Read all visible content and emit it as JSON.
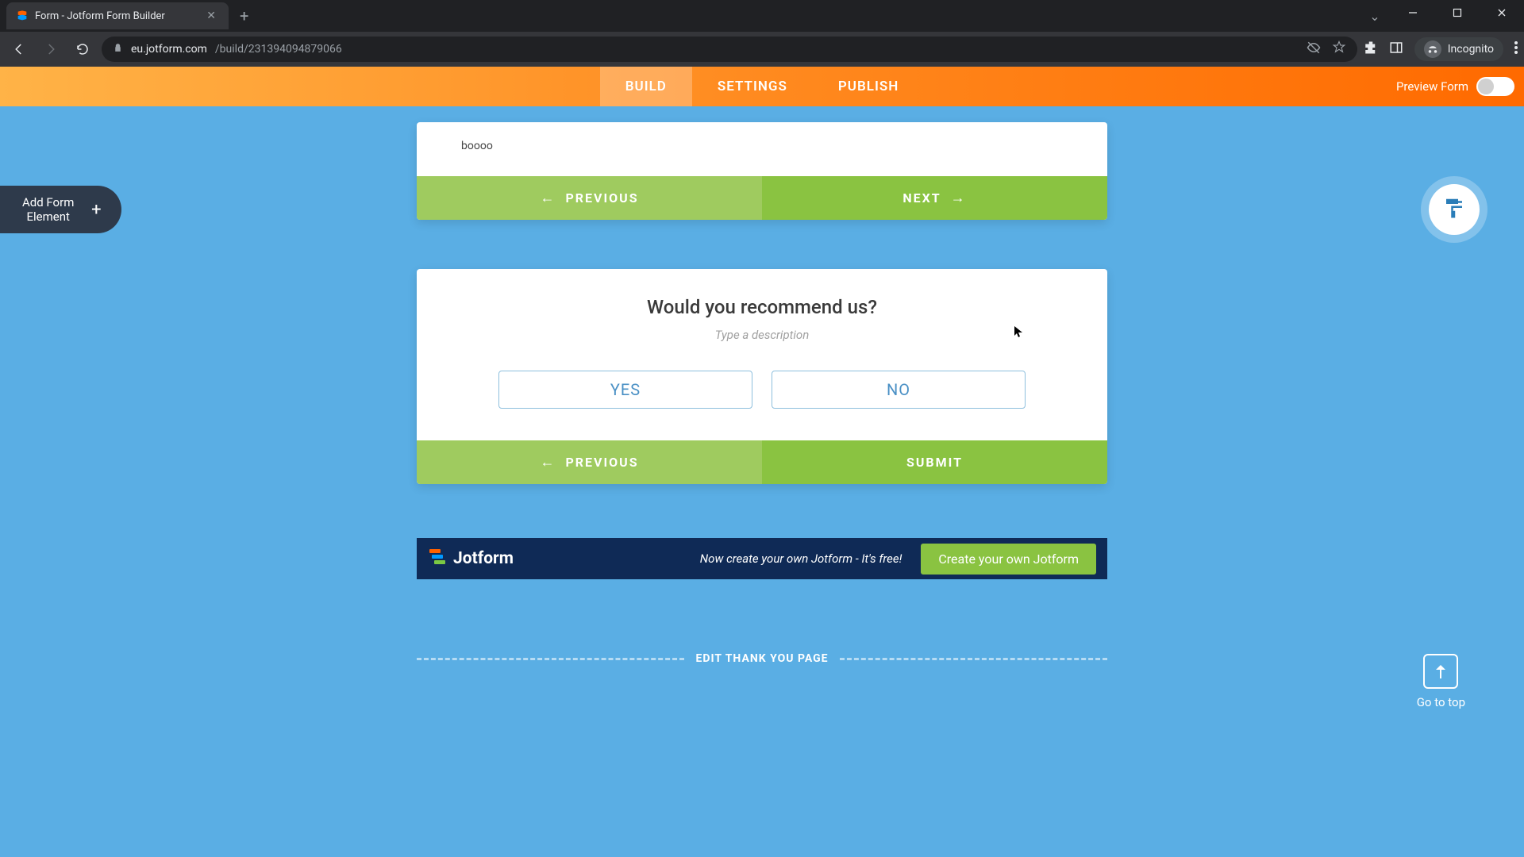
{
  "browser": {
    "tab_title": "Form - Jotform Form Builder",
    "url_host": "eu.jotform.com",
    "url_path": "/build/231394094879066",
    "incognito_label": "Incognito"
  },
  "header": {
    "tabs": {
      "build": "BUILD",
      "settings": "SETTINGS",
      "publish": "PUBLISH"
    },
    "preview_label": "Preview Form"
  },
  "sidebar": {
    "add_element_label": "Add Form\nElement"
  },
  "card1": {
    "body_text": "boooo",
    "prev_label": "PREVIOUS",
    "next_label": "NEXT"
  },
  "card2": {
    "question": "Would you recommend us?",
    "desc_placeholder": "Type a description",
    "yes_label": "YES",
    "no_label": "NO",
    "prev_label": "PREVIOUS",
    "submit_label": "SUBMIT"
  },
  "promo": {
    "brand": "Jotform",
    "text": "Now create your own Jotform - It's free!",
    "cta": "Create your own Jotform"
  },
  "misc": {
    "thank_you_label": "EDIT THANK YOU PAGE",
    "go_top_label": "Go to top"
  }
}
